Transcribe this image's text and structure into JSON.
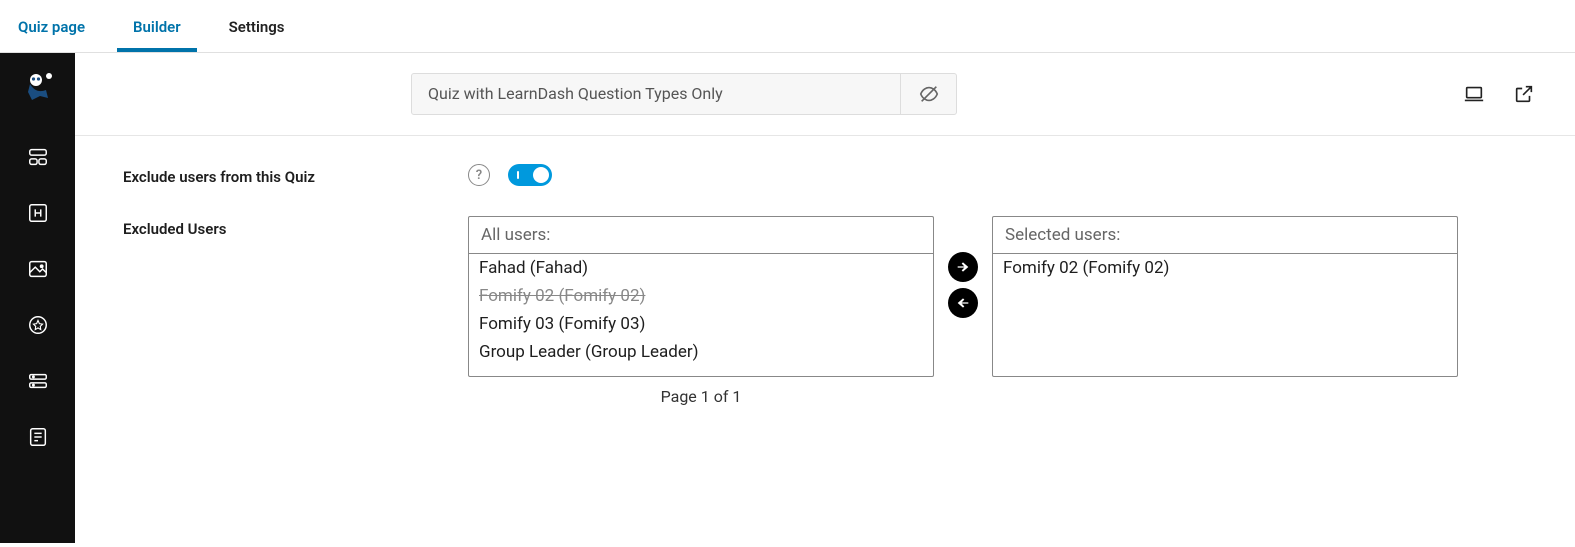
{
  "tabs": {
    "quiz_page": "Quiz page",
    "builder": "Builder",
    "settings": "Settings"
  },
  "header": {
    "quiz_title": "Quiz with LearnDash Question Types Only"
  },
  "settings": {
    "exclude_label": "Exclude users from this Quiz",
    "excluded_users_label": "Excluded Users",
    "all_users_header": "All users:",
    "selected_users_header": "Selected users:",
    "all_users": [
      {
        "label": "Fahad (Fahad)",
        "struck": false
      },
      {
        "label": "Fomify 02 (Fomify 02)",
        "struck": true
      },
      {
        "label": "Fomify 03 (Fomify 03)",
        "struck": false
      },
      {
        "label": "Group Leader (Group Leader)",
        "struck": false
      }
    ],
    "selected_users": [
      {
        "label": "Fomify 02 (Fomify 02)"
      }
    ],
    "pagination": "Page 1 of 1"
  },
  "colors": {
    "accent": "#0073aa",
    "toggle": "#0099dd"
  }
}
